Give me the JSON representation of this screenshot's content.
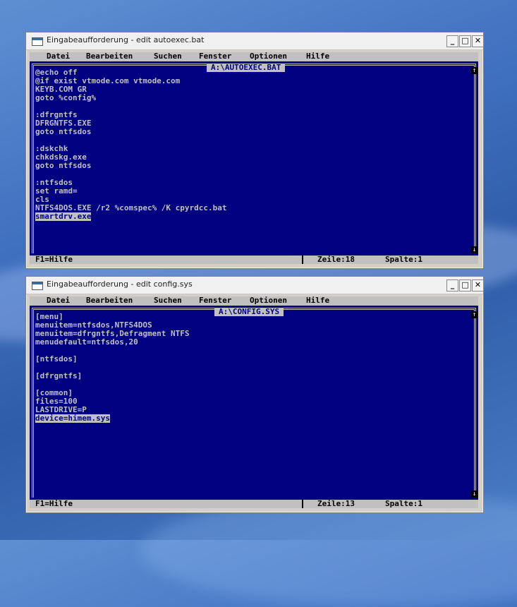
{
  "windows": [
    {
      "title": "Eingabeaufforderung - edit autoexec.bat",
      "menu": [
        "Datei",
        "Bearbeiten",
        "Suchen",
        "Fenster",
        "Optionen",
        "Hilfe"
      ],
      "file_label": "A:\\AUTOEXEC.BAT",
      "lines": [
        "@echo off",
        "@if exist vtmode.com vtmode.com",
        "KEYB.COM GR",
        "goto %config%",
        "",
        ":dfrgntfs",
        "DFRGNTFS.EXE",
        "goto ntfsdos",
        "",
        ":dskchk",
        "chkdskg.exe",
        "goto ntfsdos",
        "",
        ":ntfsdos",
        "set ramd=",
        "cls",
        "NTFS4DOS.EXE /r2 %comspec% /K cpyrdcc.bat",
        "smartdrv.exe"
      ],
      "selected_line": 18,
      "status": {
        "help": "F1=Hilfe",
        "line": "Zeile:18",
        "col": "Spalte:1"
      }
    },
    {
      "title": "Eingabeaufforderung - edit config.sys",
      "menu": [
        "Datei",
        "Bearbeiten",
        "Suchen",
        "Fenster",
        "Optionen",
        "Hilfe"
      ],
      "file_label": "A:\\CONFIG.SYS",
      "lines": [
        "[menu]",
        "menuitem=ntfsdos,NTFS4DOS",
        "menuitem=dfrgntfs,Defragment NTFS",
        "menudefault=ntfsdos,20",
        "",
        "[ntfsdos]",
        "",
        "[dfrgntfs]",
        "",
        "[common]",
        "files=100",
        "LASTDRIVE=P",
        "device=himem.sys"
      ],
      "selected_line": 13,
      "status": {
        "help": "F1=Hilfe",
        "line": "Zeile:13",
        "col": "Spalte:1"
      }
    }
  ],
  "colors": {
    "edit_bg": "#000080",
    "edit_fg": "#c0c0c0",
    "menu_bg": "#c0c0c0"
  }
}
